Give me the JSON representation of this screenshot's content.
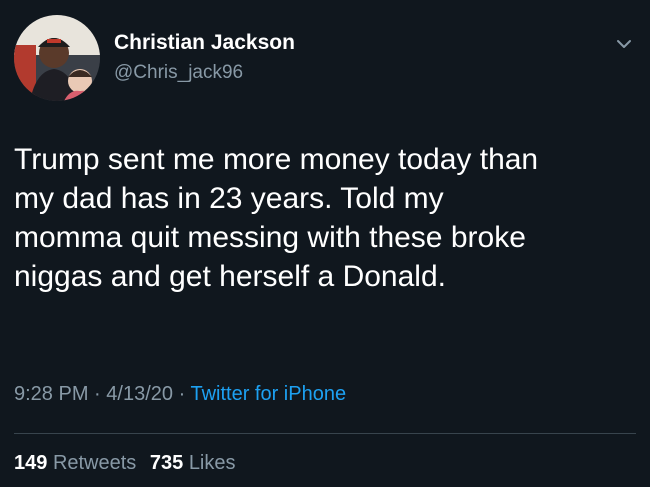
{
  "user": {
    "display_name": "Christian Jackson",
    "handle": "@Chris_jack96",
    "avatar_icon": "profile-photo"
  },
  "tweet": {
    "lines": [
      "Trump sent me more money today than",
      "my dad has in 23 years. Told my",
      "momma quit messing with these broke",
      "niggas and get herself a Donald."
    ],
    "time": "9:28 PM",
    "separator": "·",
    "date": "4/13/20",
    "source": "Twitter for iPhone"
  },
  "stats": {
    "retweets_count": "149",
    "retweets_label": "Retweets",
    "likes_count": "735",
    "likes_label": "Likes"
  },
  "colors": {
    "background": "#10171e",
    "secondary_text": "#8899a6",
    "link": "#1da1f2",
    "divider": "#38444d"
  }
}
